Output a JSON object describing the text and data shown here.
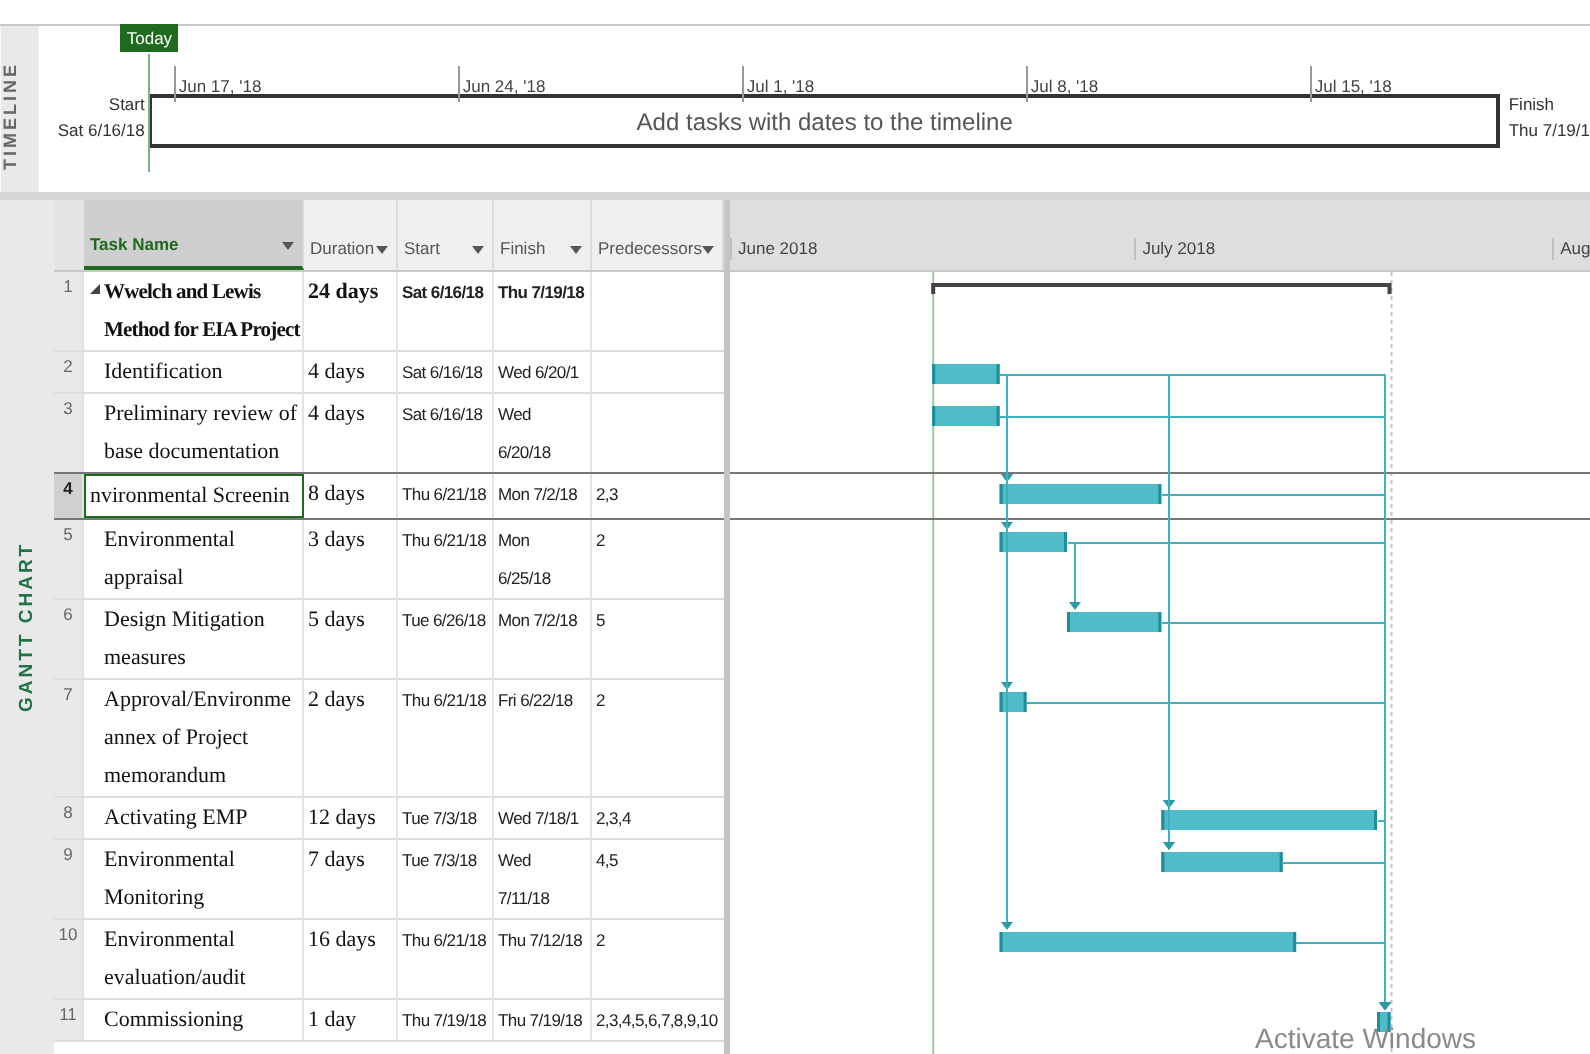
{
  "timeline": {
    "label": "TIMELINE",
    "today": "Today",
    "ticks": [
      "Jun 17, '18",
      "Jun 24, '18",
      "Jul 1, '18",
      "Jul 8, '18",
      "Jul 15, '18"
    ],
    "start_label": "Start",
    "start_date": "Sat 6/16/18",
    "placeholder": "Add tasks with dates to the timeline",
    "finish_label": "Finish",
    "finish_date": "Thu 7/19/1"
  },
  "view_label": "GANTT CHART",
  "table": {
    "columns": [
      {
        "label": "Task Name",
        "selected": true
      },
      {
        "label": "Duration",
        "selected": false
      },
      {
        "label": "Start",
        "selected": false
      },
      {
        "label": "Finish",
        "selected": false
      },
      {
        "label": "Predecessors",
        "selected": false
      }
    ],
    "rows": [
      {
        "id": "1",
        "kind": "summary",
        "expanded": true,
        "selected": false,
        "name": "Wwelch and Lewis\nMethod for EIA Project",
        "duration": "24 days",
        "start": "Sat 6/16/18",
        "finish": "Thu 7/19/18"
      },
      {
        "id": "2",
        "kind": "task",
        "selected": false,
        "name": "Identification",
        "duration": "4 days",
        "start": "Sat 6/16/18",
        "finish": "Wed 6/20/1"
      },
      {
        "id": "3",
        "kind": "task",
        "selected": false,
        "name": "Preliminary review of\nbase documentation",
        "duration": "4 days",
        "start": "Sat 6/16/18",
        "finish": "Wed\n6/20/18"
      },
      {
        "id": "4",
        "kind": "task",
        "selected": true,
        "name": "nvironmental Screenin",
        "duration": "8 days",
        "start": "Thu 6/21/18",
        "finish": "Mon 7/2/18",
        "predecessors": "2,3"
      },
      {
        "id": "5",
        "kind": "task",
        "selected": false,
        "name": "Environmental\nappraisal",
        "duration": "3 days",
        "start": "Thu 6/21/18",
        "finish": "Mon\n6/25/18",
        "predecessors": "2"
      },
      {
        "id": "6",
        "kind": "task",
        "selected": false,
        "name": "Design Mitigation\nmeasures",
        "duration": "5 days",
        "start": "Tue 6/26/18",
        "finish": "Mon 7/2/18",
        "predecessors": "5"
      },
      {
        "id": "7",
        "kind": "task",
        "selected": false,
        "name": "Approval/Environme\nannex of Project\nmemorandum",
        "duration": "2 days",
        "start": "Thu 6/21/18",
        "finish": "Fri 6/22/18",
        "predecessors": "2"
      },
      {
        "id": "8",
        "kind": "task",
        "selected": false,
        "name": "Activating EMP",
        "duration": "12 days",
        "start": "Tue 7/3/18",
        "finish": "Wed 7/18/1",
        "predecessors": "2,3,4"
      },
      {
        "id": "9",
        "kind": "task",
        "selected": false,
        "name": "Environmental\nMonitoring",
        "duration": "7 days",
        "start": "Tue 7/3/18",
        "finish": "Wed\n7/11/18",
        "predecessors": "4,5"
      },
      {
        "id": "10",
        "kind": "task",
        "selected": false,
        "name": "Environmental\nevaluation/audit",
        "duration": "16 days",
        "start": "Thu 6/21/18",
        "finish": "Thu 7/12/18",
        "predecessors": "2"
      },
      {
        "id": "11",
        "kind": "task",
        "selected": false,
        "name": "Commissioning",
        "duration": "1 day",
        "start": "Thu 7/19/18",
        "finish": "Thu 7/19/18",
        "predecessors": "2,3,4,5,6,7,8,9,10"
      }
    ]
  },
  "chart": {
    "months": [
      "June 2018",
      "July 2018",
      "Aug"
    ]
  },
  "notice": "Activate Windows"
}
